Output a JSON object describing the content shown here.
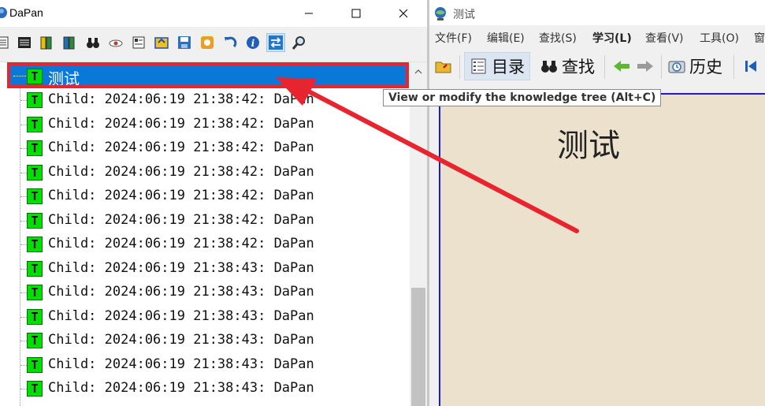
{
  "left_window": {
    "title": "DaPan",
    "toolbar_icons": [
      "list-icon",
      "library-icon",
      "book-stack-icon",
      "books-icon",
      "binoculars-icon",
      "eye-icon",
      "card-icon",
      "sync-icon",
      "save-icon",
      "record-icon",
      "undo-icon",
      "info-icon",
      "swap-icon",
      "magnifier-icon"
    ],
    "tree": {
      "root_label": "测试",
      "root_badge": "T",
      "children": [
        {
          "label": "Child: 2024:06:19 21:38:42: DaPan",
          "badge": "T"
        },
        {
          "label": "Child: 2024:06:19 21:38:42: DaPan",
          "badge": "T"
        },
        {
          "label": "Child: 2024:06:19 21:38:42: DaPan",
          "badge": "T"
        },
        {
          "label": "Child: 2024:06:19 21:38:42: DaPan",
          "badge": "T"
        },
        {
          "label": "Child: 2024:06:19 21:38:42: DaPan",
          "badge": "T"
        },
        {
          "label": "Child: 2024:06:19 21:38:42: DaPan",
          "badge": "T"
        },
        {
          "label": "Child: 2024:06:19 21:38:42: DaPan",
          "badge": "T"
        },
        {
          "label": "Child: 2024:06:19 21:38:43: DaPan",
          "badge": "T"
        },
        {
          "label": "Child: 2024:06:19 21:38:43: DaPan",
          "badge": "T"
        },
        {
          "label": "Child: 2024:06:19 21:38:43: DaPan",
          "badge": "T"
        },
        {
          "label": "Child: 2024:06:19 21:38:43: DaPan",
          "badge": "T"
        },
        {
          "label": "Child: 2024:06:19 21:38:43: DaPan",
          "badge": "T"
        },
        {
          "label": "Child: 2024:06:19 21:38:43: DaPan",
          "badge": "T"
        }
      ]
    }
  },
  "right_window": {
    "title": "测试",
    "menu": [
      "文件(F)",
      "编辑(E)",
      "查找(S)",
      "学习(L)",
      "查看(V)",
      "工具(O)",
      "窗"
    ],
    "toolbar": {
      "contents_label": "目录",
      "search_label": "查找",
      "history_label": "历史"
    },
    "tooltip": "View or modify the knowledge tree (Alt+C)",
    "content_title": "测试"
  },
  "colors": {
    "selection": "#0a78d7",
    "highlight_annotation": "#e8252f",
    "badge_green": "#00e000",
    "content_bg": "#ece1cd",
    "frame_blue": "#1a1ad8"
  }
}
